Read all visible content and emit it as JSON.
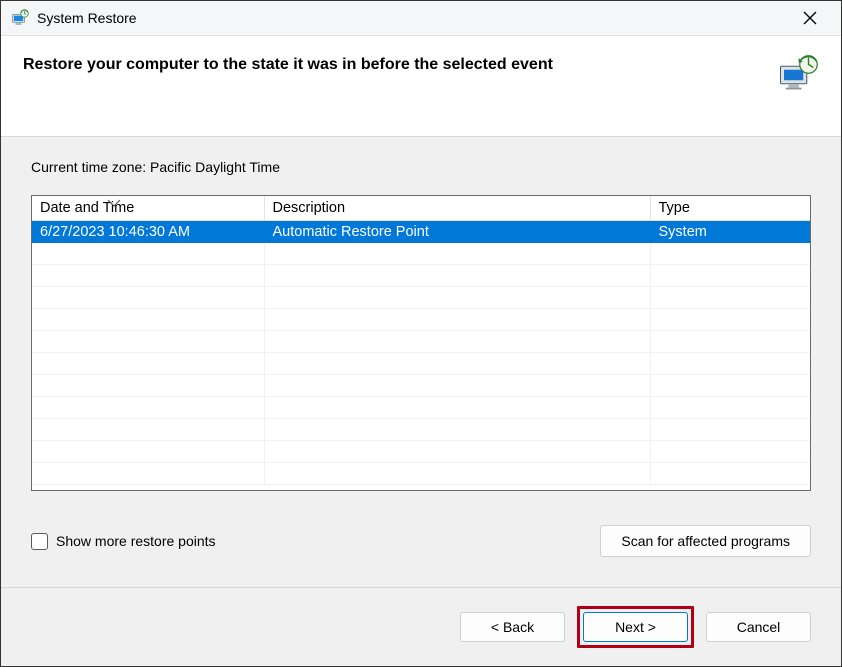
{
  "titlebar": {
    "title": "System Restore"
  },
  "header": {
    "heading": "Restore your computer to the state it was in before the selected event"
  },
  "content": {
    "timezone_label": "Current time zone: Pacific Daylight Time",
    "columns": {
      "date": "Date and Time",
      "description": "Description",
      "type": "Type"
    },
    "rows": [
      {
        "date": "6/27/2023 10:46:30 AM",
        "description": "Automatic Restore Point",
        "type": "System",
        "selected": true
      }
    ],
    "show_more_label": "Show more restore points",
    "scan_button": "Scan for affected programs"
  },
  "footer": {
    "back": "< Back",
    "next": "Next >",
    "cancel": "Cancel"
  }
}
